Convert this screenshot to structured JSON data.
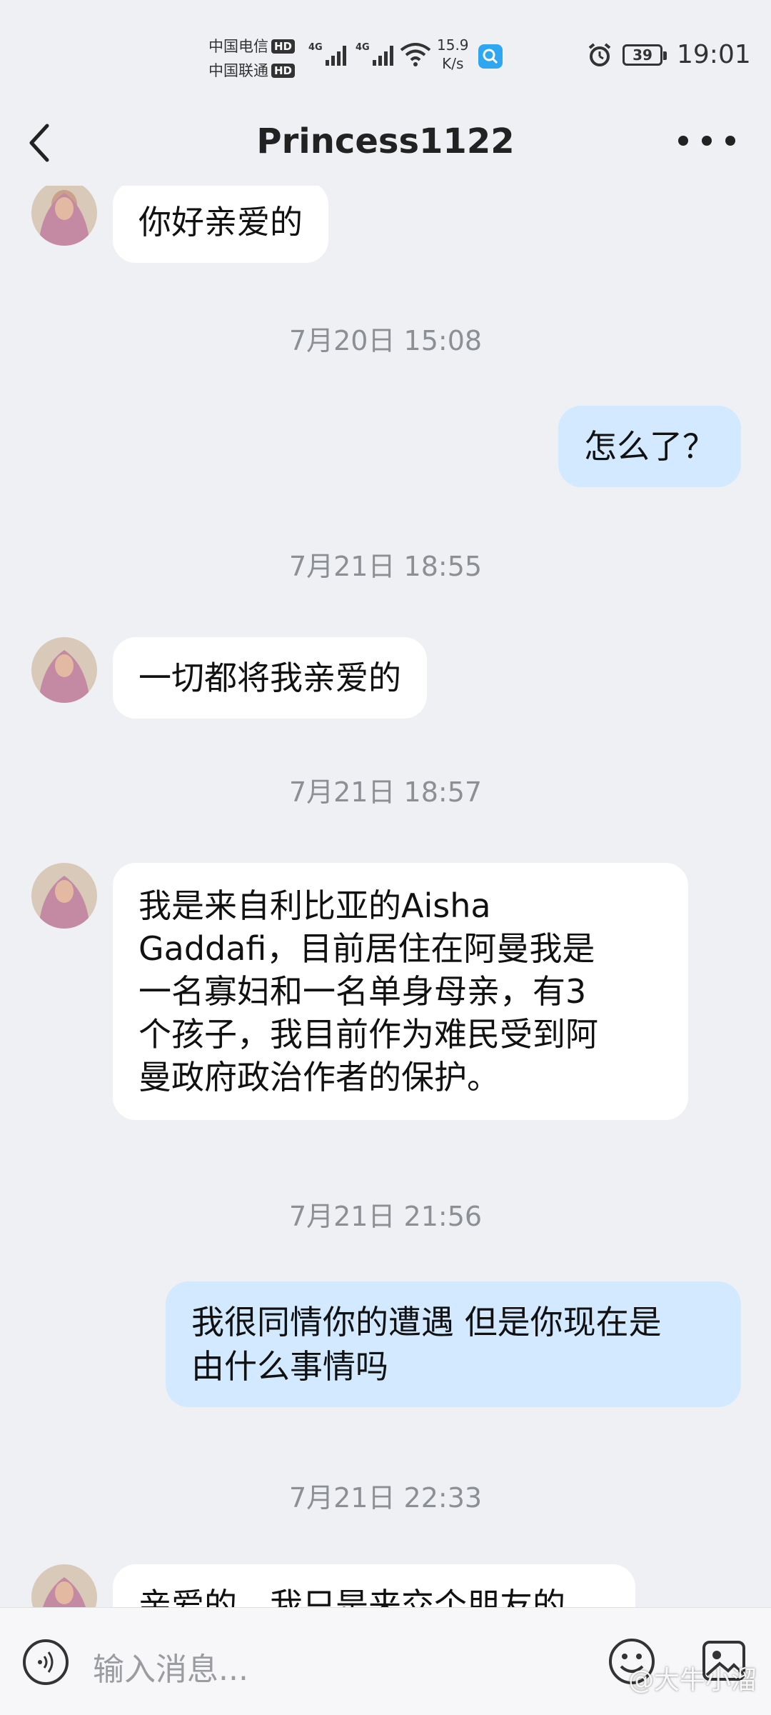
{
  "status_bar": {
    "carrier_1": "中国电信",
    "carrier_2": "中国联通",
    "hd_badge": "HD",
    "net_type": "4G",
    "net_speed_value": "15.9",
    "net_speed_unit": "K/s",
    "battery": "39",
    "time": "19:01"
  },
  "header": {
    "title": "Princess1122"
  },
  "messages": [
    {
      "kind": "in",
      "text": "你好亲爱的"
    },
    {
      "kind": "time",
      "text": "7月20日 15:08"
    },
    {
      "kind": "out",
      "text": "怎么了？"
    },
    {
      "kind": "time",
      "text": "7月21日 18:55"
    },
    {
      "kind": "in",
      "text": "一切都将我亲爱的"
    },
    {
      "kind": "time",
      "text": "7月21日 18:57"
    },
    {
      "kind": "in",
      "lines": [
        "我是来自利比亚的Aisha",
        "Gaddafi，目前居住在阿曼我是",
        "一名寡妇和一名单身母亲，有3",
        "个孩子，我目前作为难民受到阿",
        "曼政府政治作者的保护。"
      ]
    },
    {
      "kind": "time",
      "text": "7月21日 21:56"
    },
    {
      "kind": "out",
      "lines": [
        "我很同情你的遭遇 但是你现在是",
        "由什么事情吗"
      ]
    },
    {
      "kind": "time",
      "text": "7月21日 22:33"
    },
    {
      "kind": "in",
      "text": "亲爱的，我只是来交个朋友的"
    }
  ],
  "input": {
    "placeholder": "输入消息..."
  },
  "watermark": "@大牛小溜"
}
